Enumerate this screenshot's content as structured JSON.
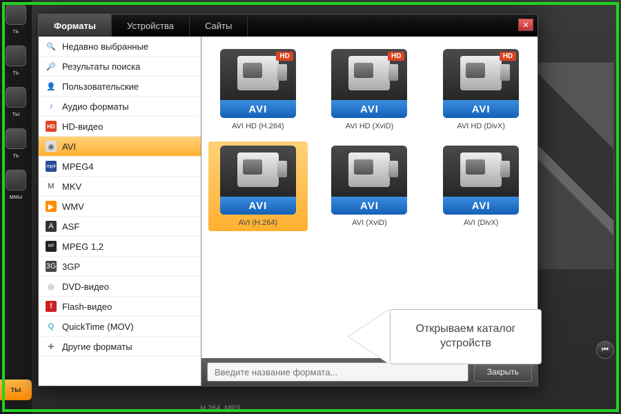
{
  "background": {
    "rail": [
      {
        "label": "ть"
      },
      {
        "label": "ть"
      },
      {
        "label": "ты"
      },
      {
        "label": "ть"
      },
      {
        "label": "ммы"
      }
    ],
    "orange_btn": "ты",
    "footer": "H.264. MP3"
  },
  "dialog": {
    "tabs": [
      {
        "label": "Форматы",
        "active": true
      },
      {
        "label": "Устройства",
        "active": false
      },
      {
        "label": "Сайты",
        "active": false
      }
    ],
    "close": "✕"
  },
  "sidebar": [
    {
      "icon": "recent",
      "label": "Недавно выбранные"
    },
    {
      "icon": "search",
      "label": "Результаты поиска"
    },
    {
      "icon": "user",
      "label": "Пользовательские"
    },
    {
      "icon": "audio",
      "label": "Аудио форматы"
    },
    {
      "icon": "hd",
      "label": "HD-видео"
    },
    {
      "icon": "avi",
      "label": "AVI",
      "selected": true
    },
    {
      "icon": "mp4",
      "label": "MPEG4"
    },
    {
      "icon": "mkv",
      "label": "MKV"
    },
    {
      "icon": "wmv",
      "label": "WMV"
    },
    {
      "icon": "asf",
      "label": "ASF"
    },
    {
      "icon": "mpeg",
      "label": "MPEG 1,2"
    },
    {
      "icon": "3gp",
      "label": "3GP"
    },
    {
      "icon": "dvd",
      "label": "DVD-видео"
    },
    {
      "icon": "flash",
      "label": "Flash-видео"
    },
    {
      "icon": "qt",
      "label": "QuickTime (MOV)"
    },
    {
      "icon": "other",
      "label": "Другие форматы"
    }
  ],
  "formats": [
    {
      "band": "AVI",
      "label": "AVI HD (H.264)",
      "hd": true
    },
    {
      "band": "AVI",
      "label": "AVI HD (XviD)",
      "hd": true
    },
    {
      "band": "AVI",
      "label": "AVI HD (DivX)",
      "hd": true
    },
    {
      "band": "AVI",
      "label": "AVI (H.264)",
      "selected": true
    },
    {
      "band": "AVI",
      "label": "AVI (XviD)"
    },
    {
      "band": "AVI",
      "label": "AVI (DivX)"
    }
  ],
  "callout": "Открываем каталог устройств",
  "search": {
    "placeholder": "Введите название формата..."
  },
  "close_btn": "Закрыть",
  "icon_glyphs": {
    "recent": "🔍",
    "search": "🔎",
    "user": "👤",
    "audio": "♪",
    "hd": "HD",
    "avi": "◉",
    "mp4": "mp4",
    "mkv": "M",
    "wmv": "▶",
    "asf": "A",
    "mpeg": "MP",
    "3gp": "3G",
    "dvd": "◎",
    "flash": "f",
    "qt": "Q",
    "other": "✚"
  }
}
